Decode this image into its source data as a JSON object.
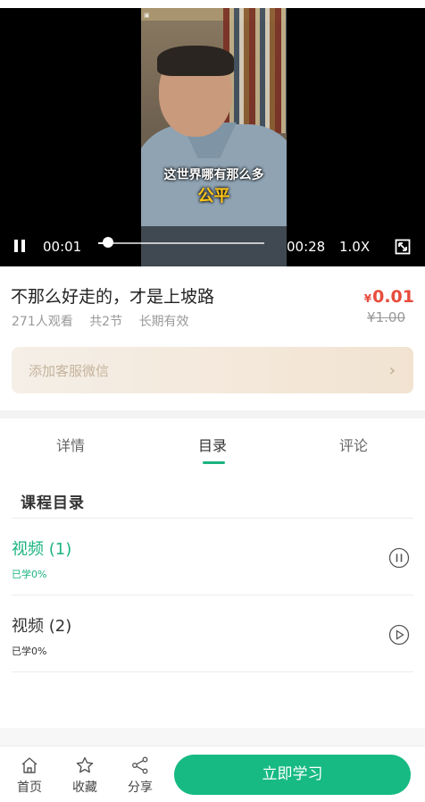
{
  "player": {
    "current_time": "00:01",
    "duration": "00:28",
    "speed": "1.0X",
    "progress_fraction": 0.06,
    "subtitle_line1": "这世界哪有那么多",
    "subtitle_line2": "公平",
    "state": "playing"
  },
  "course": {
    "title": "不那么好走的，才是上坡路",
    "views": "271人观看",
    "sections": "共2节",
    "validity": "长期有效",
    "price_symbol": "¥",
    "price": "0.01",
    "original_price": "¥1.00"
  },
  "wechat": {
    "label": "添加客服微信",
    "chevron": "›"
  },
  "tabs": [
    {
      "label": "详情"
    },
    {
      "label": "目录",
      "active": true
    },
    {
      "label": "评论"
    }
  ],
  "catalog": {
    "title": "课程目录",
    "lessons": [
      {
        "name": "视频 (1)",
        "progress": "已学0%",
        "icon": "pause-circle-icon",
        "active": true
      },
      {
        "name": "视频 (2)",
        "progress": "已学0%",
        "icon": "play-circle-icon",
        "active": false
      }
    ]
  },
  "bottom_nav": {
    "home": "首页",
    "favorite": "收藏",
    "share": "分享",
    "study_button": "立即学习"
  },
  "colors": {
    "accent": "#1cb37f",
    "button": "#17ba82",
    "price": "#e74c3c"
  }
}
